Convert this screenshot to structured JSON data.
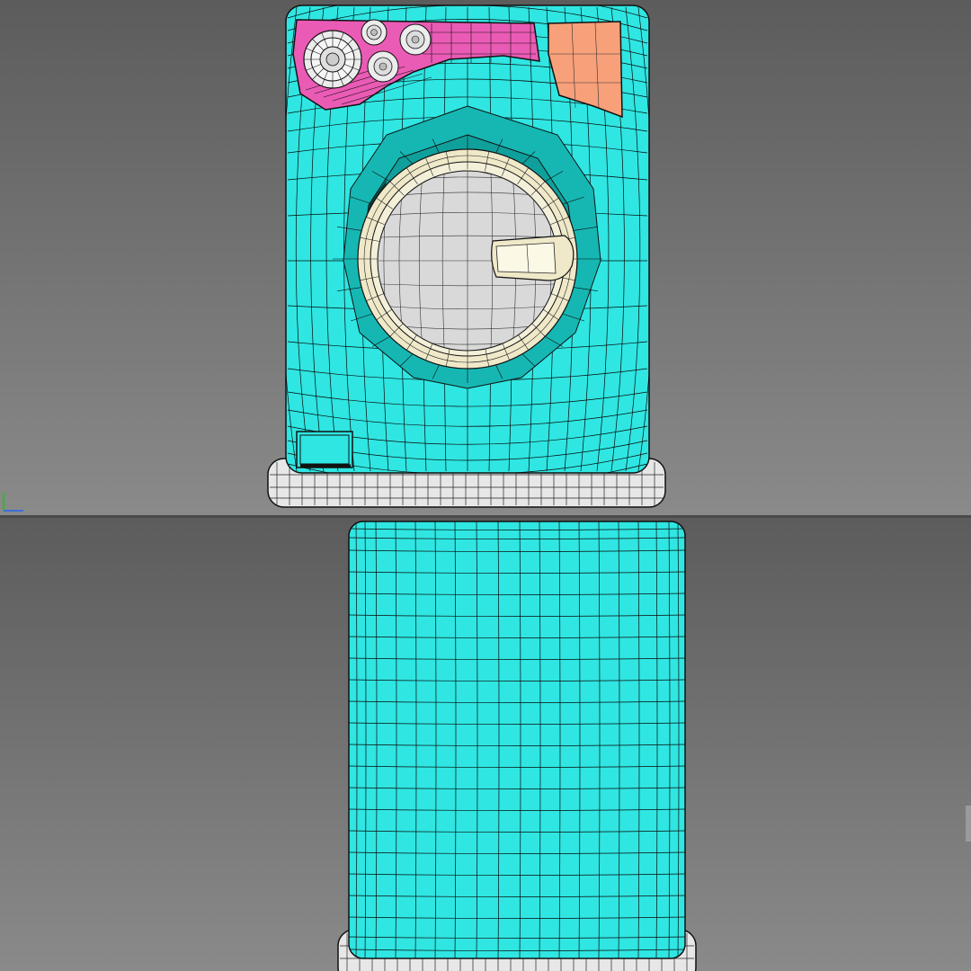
{
  "viewports": [
    {
      "name": "front",
      "background_top": "#5c5c5c",
      "background_bottom": "#8a8a8a",
      "body_color": "#2fe6e2",
      "panel_color": "#ea5bb5",
      "door_flap_color": "#f7a07a",
      "door_ring_color": "#efe9c9",
      "drum_color": "#d9d9d9",
      "base_color": "#e7e7e7",
      "wire_color": "#0a0a0a"
    },
    {
      "name": "side",
      "background_top": "#5c5c5c",
      "background_bottom": "#8a8a8a",
      "body_color": "#2fe6e2",
      "base_color": "#e7e7e7",
      "wire_color": "#0a0a0a"
    }
  ],
  "axis_gizmo_color": "#2dbb2d",
  "icons": [
    "front-view-icon",
    "side-view-icon",
    "axis-gizmo-icon"
  ]
}
